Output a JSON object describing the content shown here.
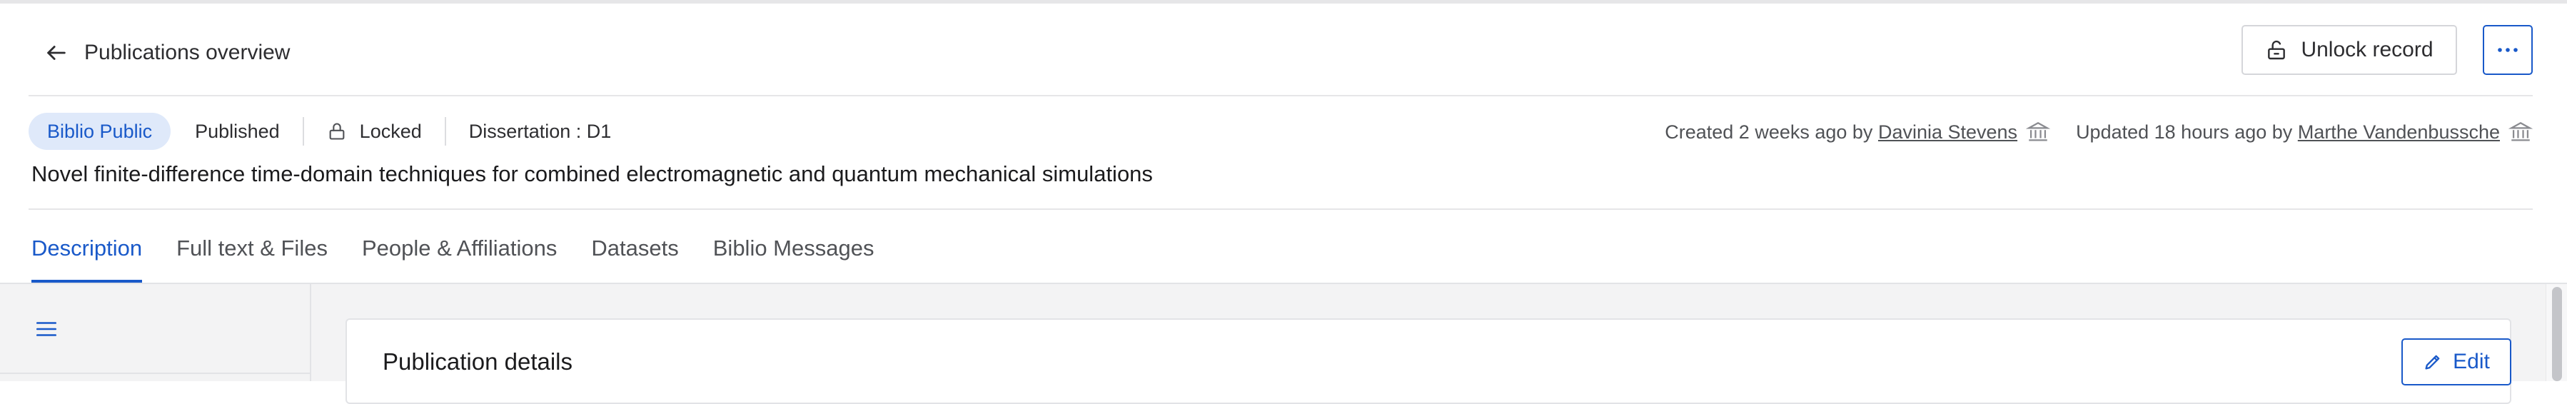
{
  "header": {
    "back_label": "Publications overview",
    "unlock_label": "Unlock record",
    "more_label": "More actions"
  },
  "status": {
    "badge": "Biblio Public",
    "published": "Published",
    "locked": "Locked",
    "type": "Dissertation : D1"
  },
  "meta": {
    "created_prefix": "Created 2 weeks ago by",
    "created_by": "Davinia Stevens",
    "updated_prefix": "Updated 18 hours ago by",
    "updated_by": "Marthe Vandenbussche"
  },
  "publication": {
    "title": "Novel finite-difference time-domain techniques for combined electromagnetic and quantum mechanical simulations"
  },
  "tabs": [
    {
      "label": "Description",
      "active": true
    },
    {
      "label": "Full text & Files",
      "active": false
    },
    {
      "label": "People & Affiliations",
      "active": false
    },
    {
      "label": "Datasets",
      "active": false
    },
    {
      "label": "Biblio Messages",
      "active": false
    }
  ],
  "card": {
    "title": "Publication details",
    "edit_label": "Edit"
  },
  "colors": {
    "accent": "#1959c9",
    "badge_bg": "#dfe9fa",
    "panel_bg": "#f3f3f4"
  },
  "icons": [
    "arrow-left-icon",
    "unlock-icon",
    "ellipsis-icon",
    "lock-icon",
    "institution-icon",
    "menu-icon",
    "pencil-icon"
  ]
}
